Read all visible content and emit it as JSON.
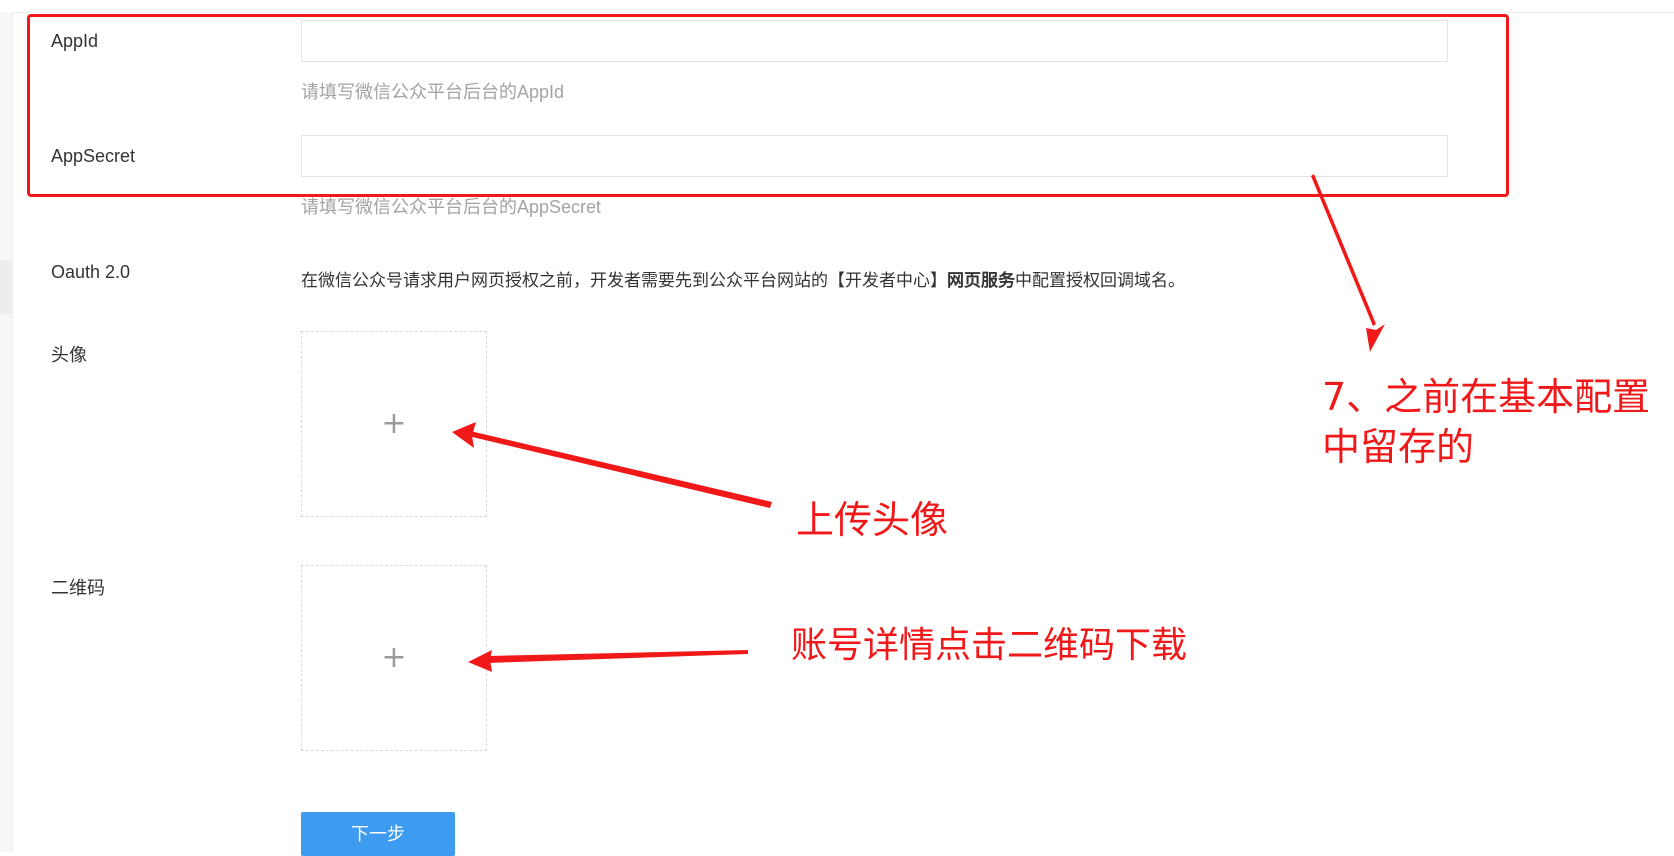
{
  "form": {
    "appid": {
      "label": "AppId",
      "value": "",
      "hint": "请填写微信公众平台后台的AppId"
    },
    "appsecret": {
      "label": "AppSecret",
      "value": "",
      "hint": "请填写微信公众平台后台的AppSecret"
    },
    "oauth": {
      "label": "Oauth 2.0",
      "text_before": "在微信公众号请求用户网页授权之前，开发者需要先到公众平台网站的【开发者中心】",
      "text_bold": "网页服务",
      "text_after": "中配置授权回调域名。"
    },
    "avatar": {
      "label": "头像",
      "icon": "plus-icon",
      "glyph": "+"
    },
    "qrcode": {
      "label": "二维码",
      "icon": "plus-icon",
      "glyph": "+"
    },
    "next_button": {
      "label": "下一步"
    }
  },
  "annotations": {
    "config_note_line1": "7、之前在基本配置",
    "config_note_line2": "中留存的",
    "upload_avatar_note": "上传头像",
    "qrcode_note": "账号详情点击二维码下载"
  },
  "colors": {
    "annotation_red": "#f01818",
    "primary_button": "#3d9bf0",
    "hint_text": "#a3a3a3"
  }
}
